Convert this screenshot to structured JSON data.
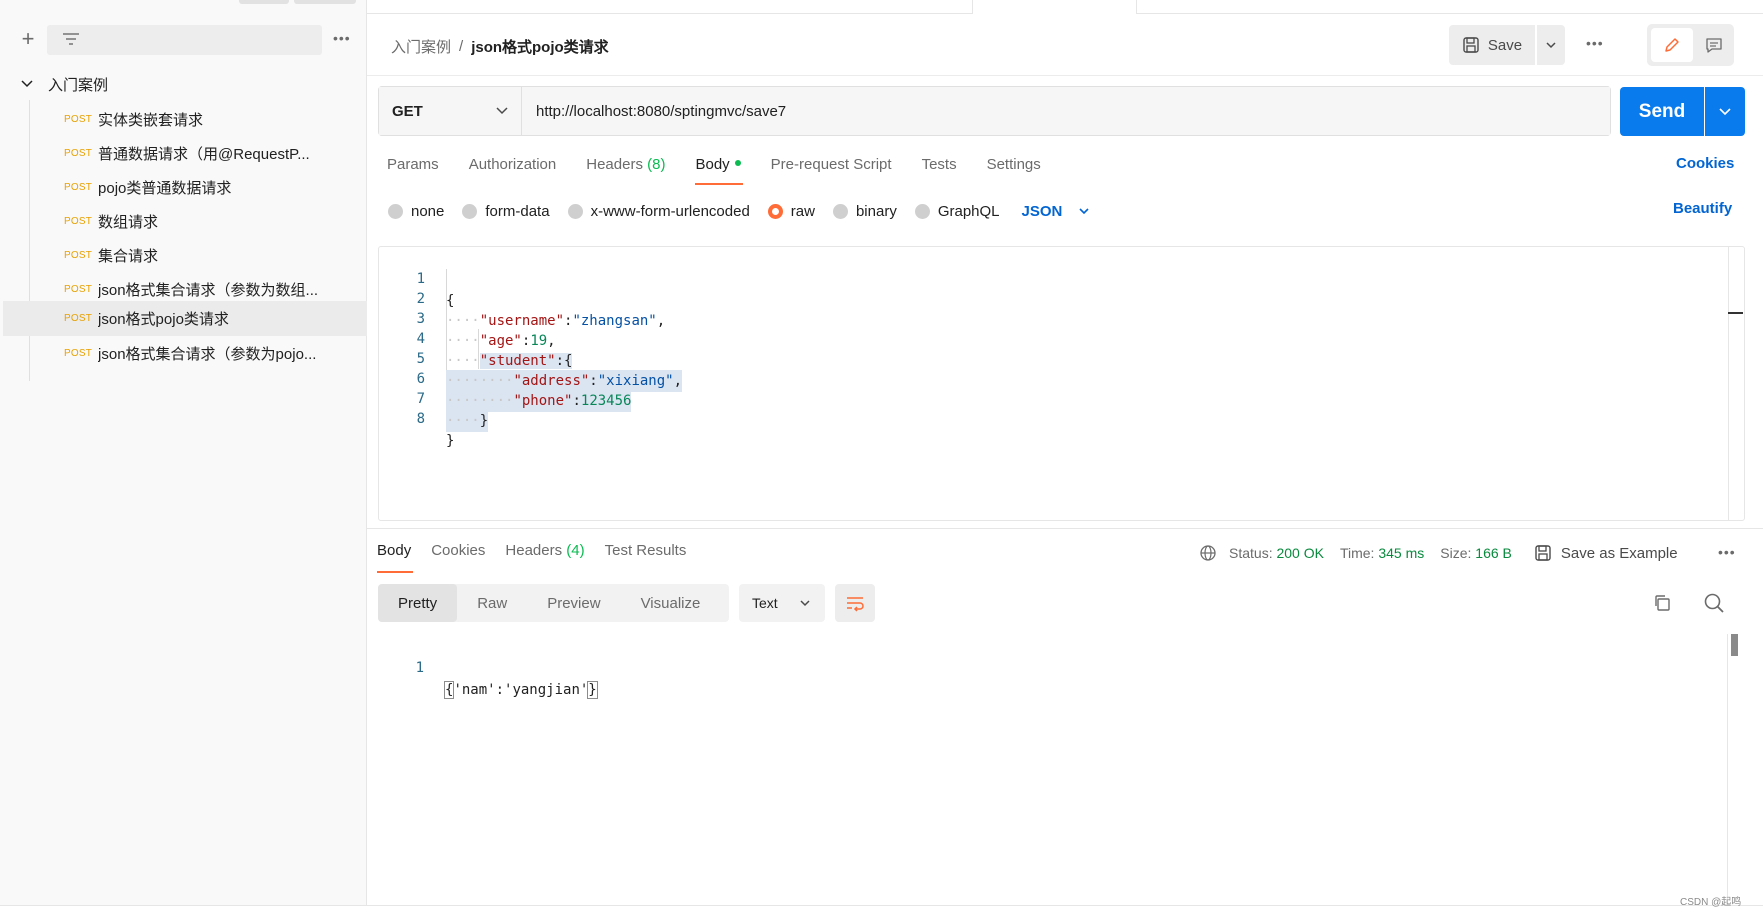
{
  "sidebar": {
    "folder": "入门案例",
    "requests": [
      {
        "method": "POST",
        "name": "实体类嵌套请求"
      },
      {
        "method": "POST",
        "name": "普通数据请求（用@RequestP..."
      },
      {
        "method": "POST",
        "name": "pojo类普通数据请求"
      },
      {
        "method": "POST",
        "name": "数组请求"
      },
      {
        "method": "POST",
        "name": "集合请求"
      },
      {
        "method": "POST",
        "name": "json格式集合请求（参数为数组..."
      },
      {
        "method": "POST",
        "name": "json格式pojo类请求",
        "active": true
      },
      {
        "method": "POST",
        "name": "json格式集合请求（参数为pojo..."
      }
    ]
  },
  "header": {
    "breadcrumb_parent": "入门案例",
    "breadcrumb_sep": "/",
    "breadcrumb_current": "json格式pojo类请求",
    "save_label": "Save"
  },
  "request": {
    "method": "GET",
    "url": "http://localhost:8080/sptingmvc/save7",
    "send_label": "Send",
    "tabs": {
      "params": "Params",
      "authorization": "Authorization",
      "headers": "Headers",
      "headers_count": "(8)",
      "body": "Body",
      "prerequest": "Pre-request Script",
      "tests": "Tests",
      "settings": "Settings"
    },
    "cookies_label": "Cookies",
    "body_types": {
      "none": "none",
      "form_data": "form-data",
      "urlencoded": "x-www-form-urlencoded",
      "raw": "raw",
      "binary": "binary",
      "graphql": "GraphQL"
    },
    "body_language": "JSON",
    "beautify_label": "Beautify",
    "body_lines": [
      "1",
      "2",
      "3",
      "4",
      "5",
      "6",
      "7",
      "8"
    ]
  },
  "code": {
    "l1": "{",
    "username_key": "\"username\"",
    "username_val": "\"zhangsan\"",
    "age_key": "\"age\"",
    "age_val": "19",
    "student_key": "\"student\"",
    "address_key": "\"address\"",
    "address_val": "\"xixiang\"",
    "phone_key": "\"phone\"",
    "phone_val": "123456",
    "close_inner": "}",
    "close_outer": "}"
  },
  "response": {
    "tabs": {
      "body": "Body",
      "cookies": "Cookies",
      "headers": "Headers",
      "headers_count": "(4)",
      "test_results": "Test Results"
    },
    "status_label": "Status:",
    "status_value": "200 OK",
    "time_label": "Time:",
    "time_value": "345 ms",
    "size_label": "Size:",
    "size_value": "166 B",
    "save_example_label": "Save as Example",
    "formats": {
      "pretty": "Pretty",
      "raw": "Raw",
      "preview": "Preview",
      "visualize": "Visualize"
    },
    "text_select": "Text",
    "line_number": "1",
    "body_open": "{",
    "body_content": "'nam':'yangjian'",
    "body_close": "}"
  },
  "watermark": "CSDN @起鸣",
  "colors": {
    "accent": "#ff6c37",
    "primary": "#097bed",
    "link": "#0265d2",
    "method_post": "#e8a200",
    "success": "#0cbb52"
  }
}
